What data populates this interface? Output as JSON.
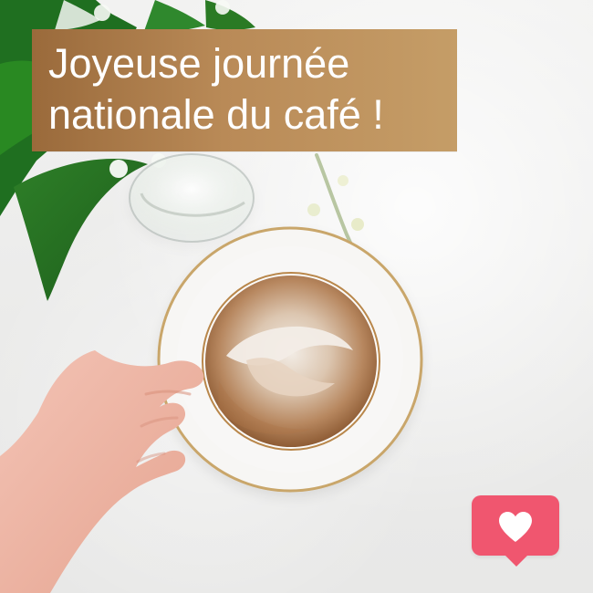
{
  "headline": {
    "line1": "Joyeuse journée",
    "line2": "nationale du café !"
  },
  "colors": {
    "background": "#ecebea",
    "headline_background": "#b98a57",
    "headline_text": "#ffffff",
    "like_badge": "#f0566f",
    "heart": "#ffffff"
  },
  "icons": {
    "like": "heart-icon"
  }
}
